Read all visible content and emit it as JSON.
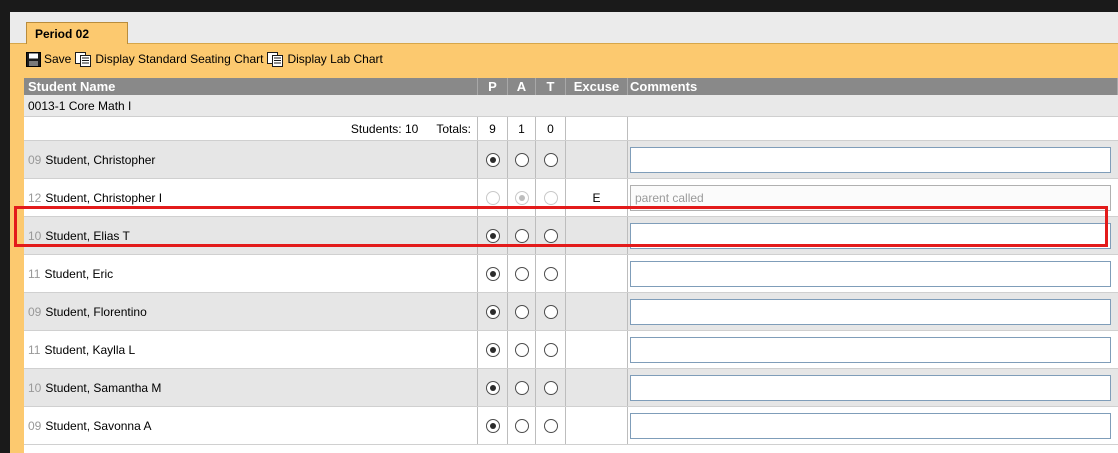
{
  "tab": {
    "label": "Period 02"
  },
  "toolbar": {
    "save_label": "Save",
    "seating_label": "Display Standard Seating Chart",
    "lab_label": "Display Lab Chart"
  },
  "table": {
    "headers": {
      "name": "Student Name",
      "p": "P",
      "a": "A",
      "t": "T",
      "excuse": "Excuse",
      "comments": "Comments"
    },
    "course": "0013-1 Core Math I",
    "totals": {
      "students_label": "Students: 10",
      "totals_label": "Totals:",
      "p": "9",
      "a": "1",
      "t": "0"
    },
    "students": [
      {
        "grade": "09",
        "name": "Student, Christopher",
        "status": "P",
        "excuse": "",
        "comment": "",
        "disabled": false
      },
      {
        "grade": "12",
        "name": "Student, Christopher I",
        "status": "A",
        "excuse": "E",
        "comment": "parent called",
        "disabled": true
      },
      {
        "grade": "10",
        "name": "Student, Elias T",
        "status": "P",
        "excuse": "",
        "comment": "",
        "disabled": false
      },
      {
        "grade": "11",
        "name": "Student, Eric",
        "status": "P",
        "excuse": "",
        "comment": "",
        "disabled": false
      },
      {
        "grade": "09",
        "name": "Student, Florentino",
        "status": "P",
        "excuse": "",
        "comment": "",
        "disabled": false
      },
      {
        "grade": "11",
        "name": "Student, Kaylla L",
        "status": "P",
        "excuse": "",
        "comment": "",
        "disabled": false
      },
      {
        "grade": "10",
        "name": "Student, Samantha M",
        "status": "P",
        "excuse": "",
        "comment": "",
        "disabled": false
      },
      {
        "grade": "09",
        "name": "Student, Savonna A",
        "status": "P",
        "excuse": "",
        "comment": "",
        "disabled": false
      }
    ]
  },
  "colors": {
    "tab_bg": "#fcc96f",
    "header_bg": "#898989",
    "highlight": "#e31b1b"
  }
}
